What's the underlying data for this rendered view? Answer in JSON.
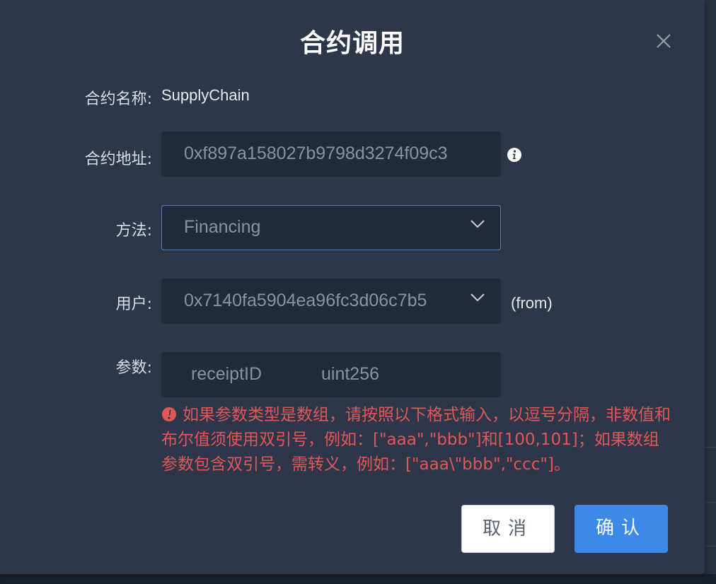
{
  "dialog": {
    "title": "合约调用",
    "close_icon": "close-icon"
  },
  "form": {
    "contract_name_label": "合约名称:",
    "contract_name_value": "SupplyChain",
    "contract_address_label": "合约地址:",
    "contract_address_value": "0xf897a158027b9798d3274f09c3",
    "method_label": "方法:",
    "method_value": "Financing",
    "user_label": "用户:",
    "user_value": "0x7140fa5904ea96fc3d06c7b5",
    "user_suffix": "(from)",
    "params_label": "参数:",
    "param_name": "receiptID",
    "param_type": "uint256",
    "warning_text": "如果参数类型是数组，请按照以下格式输入，以逗号分隔，非数值和布尔值须使用双引号，例如：[\"aaa\",\"bbb\"]和[100,101]；如果数组参数包含双引号，需转义，例如：[\"aaa\\\"bbb\",\"ccc\"]。"
  },
  "buttons": {
    "cancel_label": "取消",
    "confirm_label": "确认"
  },
  "colors": {
    "dialog_bg": "#2e3749",
    "field_bg": "#232b3b",
    "accent": "#3d8ae6",
    "warning": "#e0575a"
  }
}
